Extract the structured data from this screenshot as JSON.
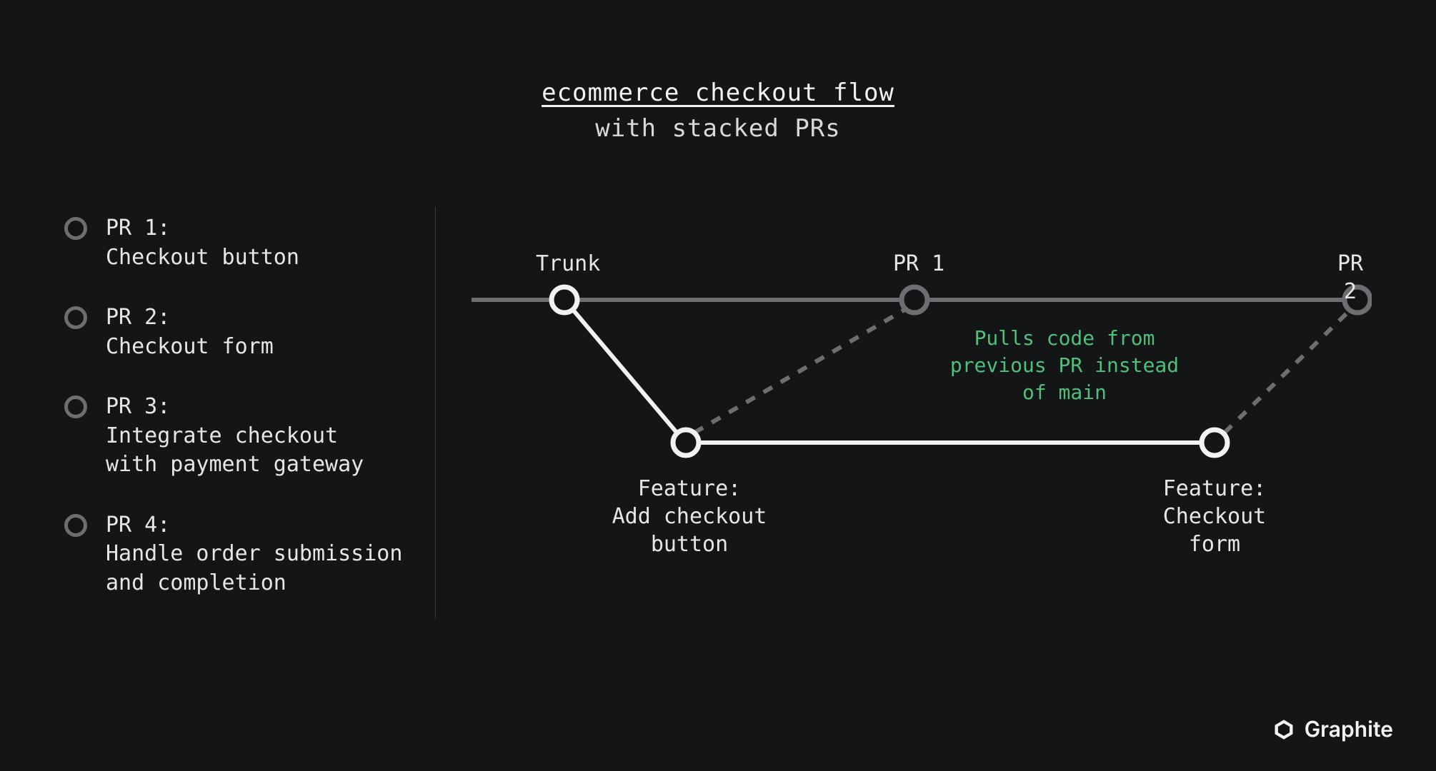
{
  "header": {
    "title": "ecommerce checkout flow",
    "subtitle": "with stacked PRs"
  },
  "sidebar": {
    "items": [
      {
        "label": "PR 1:\nCheckout button"
      },
      {
        "label": "PR 2:\nCheckout form"
      },
      {
        "label": "PR 3:\nIntegrate checkout\nwith payment gateway"
      },
      {
        "label": "PR 4:\nHandle order submission\nand completion"
      }
    ]
  },
  "diagram": {
    "trunk_label": "Trunk",
    "pr1_label": "PR 1",
    "pr2_label": "PR 2",
    "feature1_label": "Feature:\nAdd checkout\nbutton",
    "feature2_label": "Feature:\nCheckout\nform",
    "annotation": "Pulls code from\nprevious PR instead\nof main"
  },
  "brand": {
    "name": "Graphite"
  }
}
